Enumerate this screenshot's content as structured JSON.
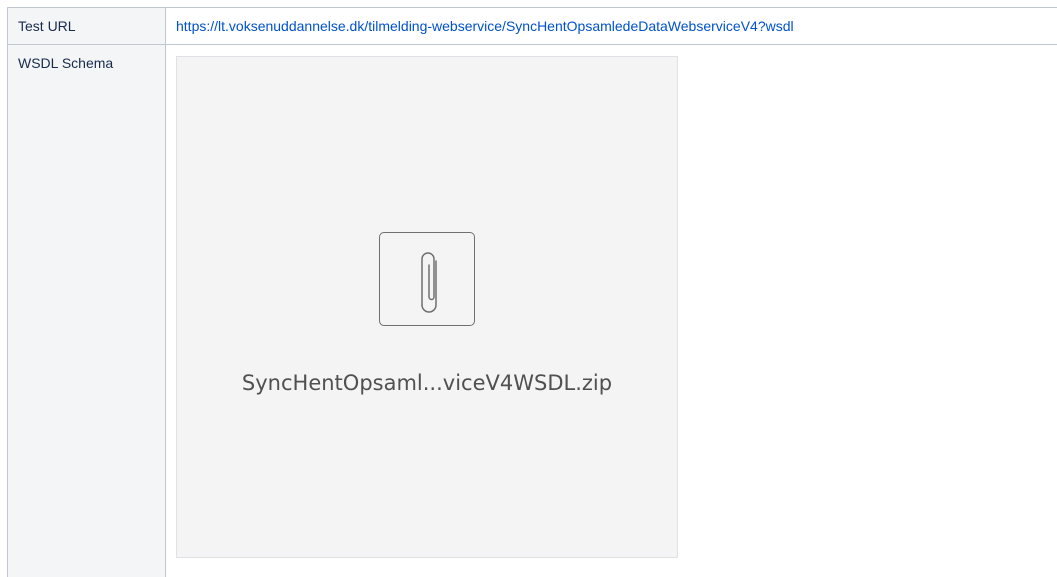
{
  "table": {
    "rows": [
      {
        "header": "Test URL",
        "link_text": "https://lt.voksenuddannelse.dk/tilmelding-webservice/SyncHentOpsamledeDataWebserviceV4?wsdl"
      },
      {
        "header": "WSDL Schema",
        "attachment": {
          "file_name": "SyncHentOpsaml...viceV4WSDL.zip",
          "icon": "paperclip-icon"
        }
      }
    ]
  },
  "colors": {
    "link": "#0052cc",
    "header_bg": "#f4f5f7",
    "border": "#c1c7d0",
    "card_bg": "#f4f4f4"
  }
}
